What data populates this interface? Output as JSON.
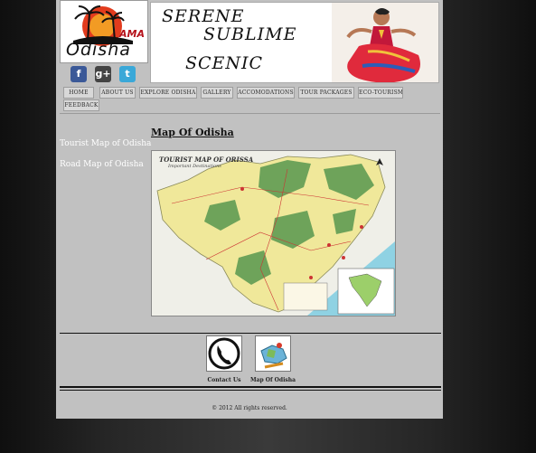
{
  "logo": {
    "brand": "Odisha",
    "tag": "AMA"
  },
  "banner": {
    "word1": "SERENE",
    "word2": "SUBLIME",
    "word3": "SCENIC"
  },
  "social": [
    {
      "name": "facebook",
      "glyph": "f",
      "color": "#3b5998"
    },
    {
      "name": "google-plus",
      "glyph": "g+",
      "color": "#444444"
    },
    {
      "name": "twitter",
      "glyph": "t",
      "color": "#3aa8d8"
    }
  ],
  "nav": [
    "HOME",
    "ABOUT US",
    "EXPLORE ODISHA",
    "GALLERY",
    "ACCOMODATIONS",
    "TOUR PACKAGES",
    "ECO-TOURISM",
    "FEEDBACK"
  ],
  "sidebar": {
    "links": [
      "Tourist Map of Odisha",
      "Road Map of Odisha"
    ]
  },
  "main": {
    "title": "Map Of Odisha",
    "map_title": "TOURIST MAP OF ORISSA",
    "map_subtitle": "Important Destinations"
  },
  "footer": {
    "links": [
      "Contact Us",
      "Map Of Odisha"
    ],
    "copyright": "© 2012 All rights reserved."
  },
  "colors": {
    "page_bg": "#c1c1c1",
    "map_land": "#f0e89a",
    "forest": "#6ea35a",
    "sea": "#8fd2e3"
  }
}
